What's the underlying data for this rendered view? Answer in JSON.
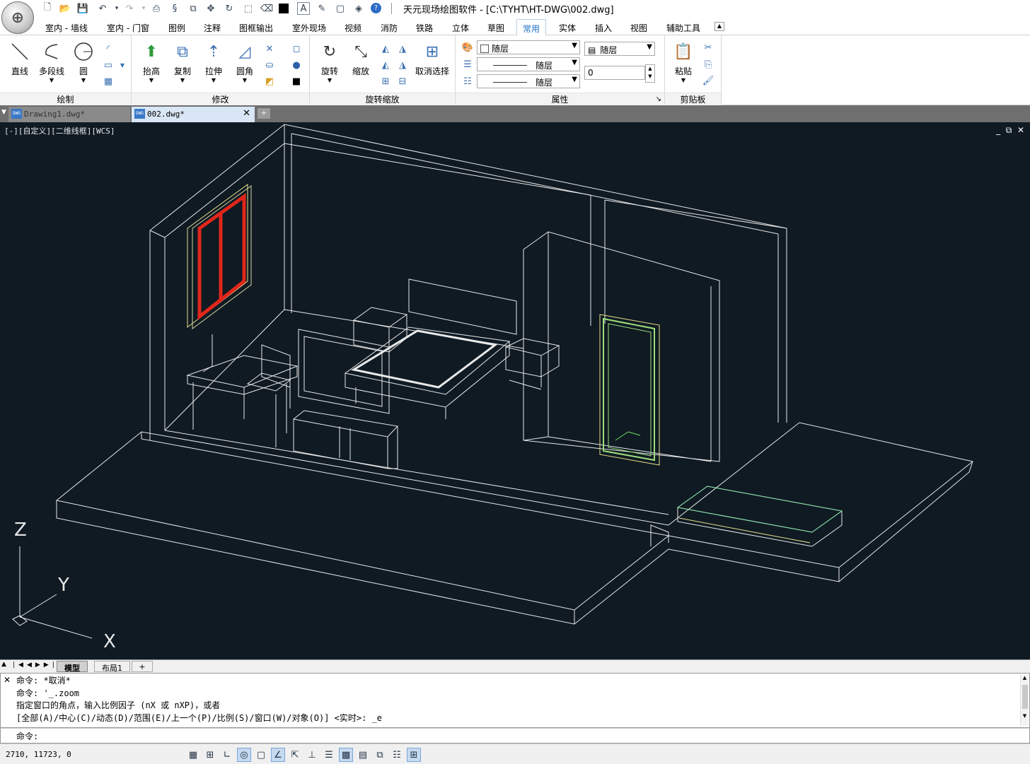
{
  "title": {
    "app_name": "天元现场绘图软件",
    "file_path": "[C:\\TYHT\\HT-DWG\\002.dwg]"
  },
  "quick_access": [
    "new-icon",
    "open-icon",
    "save-icon",
    "undo-icon",
    "redo-icon",
    "print-icon",
    "ss-icon",
    "copy-window-icon",
    "move-icon",
    "rotate-icon",
    "select-icon",
    "eraser-icon",
    "color-icon",
    "text-icon",
    "edit-icon",
    "cube-icon",
    "render-icon",
    "help-icon"
  ],
  "ribbon_tabs": [
    "室内 - 墙线",
    "室内 - 门窗",
    "图例",
    "注释",
    "图框输出",
    "室外现场",
    "视频",
    "消防",
    "铁路",
    "立体",
    "草图",
    "常用",
    "实体",
    "插入",
    "视图",
    "辅助工具"
  ],
  "active_tab": "常用",
  "ribbon": {
    "draw": {
      "title": "绘制",
      "line": "直线",
      "polyline": "多段线",
      "circle": "圆"
    },
    "modify": {
      "title": "修改",
      "raise": "抬高",
      "copy": "复制",
      "stretch": "拉伸",
      "fillet": "圆角"
    },
    "rotate_scale": {
      "title": "旋转缩放",
      "rotate": "旋转",
      "scale": "缩放",
      "deselect": "取消选择"
    },
    "properties": {
      "title": "属性",
      "layer": "随层",
      "linetype": "随层",
      "lineweight": "随层",
      "color_layer": "随层",
      "value": "0"
    },
    "clipboard": {
      "title": "剪贴板",
      "paste": "粘贴"
    }
  },
  "doc_tabs": [
    {
      "label": "Drawing1.dwg*"
    },
    {
      "label": "002.dwg*"
    }
  ],
  "view_label": "[-][自定义][二维线框][WCS]",
  "axes": {
    "z": "Z",
    "y": "Y",
    "x": "X"
  },
  "layout_tabs": [
    "模型",
    "布局1",
    "+"
  ],
  "command_history": [
    "命令: *取消*",
    "命令: '_.zoom",
    "指定窗口的角点，输入比例因子 (nX 或 nXP)，或者",
    "[全部(A)/中心(C)/动态(D)/范围(E)/上一个(P)/比例(S)/窗口(W)/对象(O)] <实时>: _e"
  ],
  "command_prompt": "命令:",
  "status": {
    "coords": "2710, 11723, 0"
  },
  "colors": {
    "canvas_bg": "#0f1a23",
    "wire": "#e8e8e8",
    "window_red": "#e0261b",
    "door_green": "#9ee07a",
    "accent": "#1e6fc4"
  }
}
